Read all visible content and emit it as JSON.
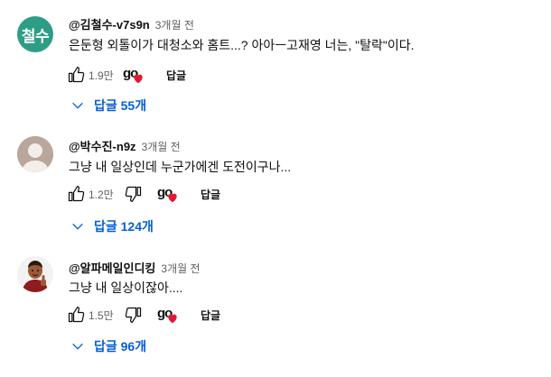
{
  "comments": [
    {
      "handle": "@김철수-v7s9n",
      "time": "3개월 전",
      "text": "은둔형 외톨이가 대청소와 홈트...? 아아ㅡ고재영 너는, \"탈락\"이다.",
      "likes": "1.9만",
      "reply_label": "답글",
      "replies_label": "답글 55개",
      "avatar": {
        "type": "initials",
        "text": "철수",
        "color": "#2e9d86"
      },
      "creator_badge": "go",
      "show_dislike": false
    },
    {
      "handle": "@박수진-n9z",
      "time": "3개월 전",
      "text": "그냥 내 일상인데 누군가에겐 도전이구나...",
      "likes": "1.2만",
      "reply_label": "답글",
      "replies_label": "답글 124개",
      "avatar": {
        "type": "default-person",
        "color": "#b9a79c"
      },
      "creator_badge": "go",
      "show_dislike": true
    },
    {
      "handle": "@알파메일인디킹",
      "time": "3개월 전",
      "text": "그냥 내 일상이잖아....",
      "likes": "1.5만",
      "reply_label": "답글",
      "replies_label": "답글 96개",
      "avatar": {
        "type": "photo",
        "description_icon": "boy-thumbs-up"
      },
      "creator_badge": "go",
      "show_dislike": true
    }
  ],
  "icons": {
    "like": "thumbs-up-icon",
    "dislike": "thumbs-down-icon",
    "heart": "heart-icon",
    "expand": "chevron-down-icon"
  },
  "colors": {
    "link_blue": "#065fd4",
    "heart_red": "#e1182f",
    "secondary_text": "#606060"
  }
}
